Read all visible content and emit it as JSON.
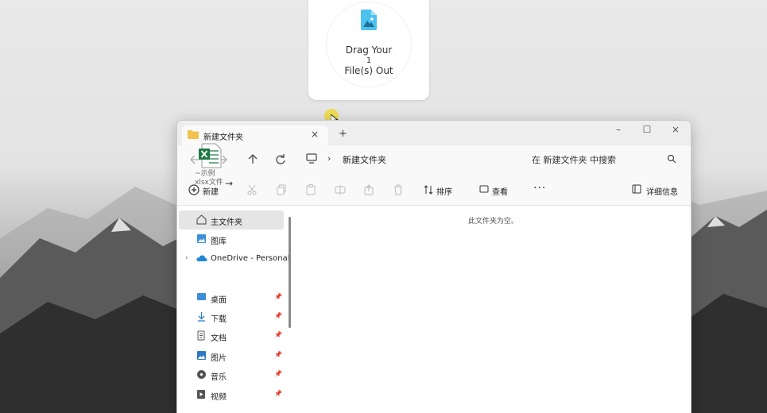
{
  "drag_widget": {
    "line1": "Drag Your",
    "count": "1",
    "line2": "File(s) Out",
    "icon": "image-file-icon",
    "accent": "#4cc2f0"
  },
  "window": {
    "tab_title": "新建文件夹",
    "tab_close": "×",
    "new_tab": "+",
    "minimize": "–",
    "maximize": "☐",
    "close": "×"
  },
  "nav": {
    "breadcrumb_chevron": "›",
    "path": "新建文件夹",
    "search_placeholder": "在 新建文件夹 中搜索"
  },
  "toolbar": {
    "new_label": "新建",
    "sort_label": "排序",
    "view_label": "查看",
    "more": "···",
    "details_label": "详细信息"
  },
  "dragged_file": {
    "label_line1": "~示例",
    "label_line2": "xlsx文件",
    "arrow": "→",
    "icon_color": "#1d7a45"
  },
  "sidebar": {
    "items": [
      {
        "label": "主文件夹",
        "icon": "home-icon"
      },
      {
        "label": "图库",
        "icon": "gallery-icon"
      },
      {
        "label": "OneDrive - Personal",
        "icon": "cloud-icon",
        "expand": "›"
      },
      {
        "label": "桌面",
        "icon": "desktop-icon",
        "pin": "📌"
      },
      {
        "label": "下载",
        "icon": "download-icon",
        "pin": "📌"
      },
      {
        "label": "文档",
        "icon": "document-icon",
        "pin": "📌"
      },
      {
        "label": "图片",
        "icon": "picture-icon",
        "pin": "📌"
      },
      {
        "label": "音乐",
        "icon": "music-icon",
        "pin": "📌"
      },
      {
        "label": "视频",
        "icon": "video-icon",
        "pin": "📌"
      }
    ]
  },
  "content": {
    "empty_message": "此文件夹为空。"
  },
  "colors": {
    "folder": "#f2c14e",
    "onedrive": "#1e88d6",
    "excel": "#1d7a45"
  }
}
